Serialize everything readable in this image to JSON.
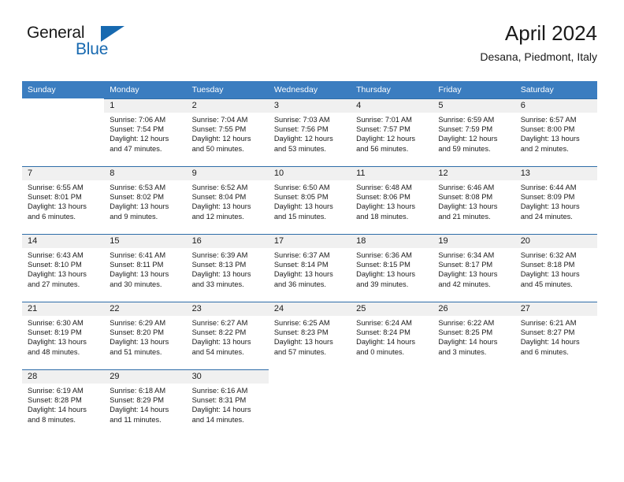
{
  "brand": {
    "name_part1": "General",
    "name_part2": "Blue",
    "logo_icon": "triangle-logo-icon"
  },
  "header": {
    "month_title": "April 2024",
    "location": "Desana, Piedmont, Italy"
  },
  "colors": {
    "header_blue": "#3b7dc0",
    "row_divider_blue": "#2e6da8",
    "daynum_background": "#f0f0f0",
    "brand_blue": "#1769b0",
    "text": "#1a1a1a"
  },
  "calendar": {
    "weekday_headers": [
      "Sunday",
      "Monday",
      "Tuesday",
      "Wednesday",
      "Thursday",
      "Friday",
      "Saturday"
    ],
    "weeks": [
      {
        "days": [
          {
            "day": "",
            "sunrise": "",
            "sunset": "",
            "daylight_line1": "",
            "daylight_line2": ""
          },
          {
            "day": "1",
            "sunrise": "Sunrise: 7:06 AM",
            "sunset": "Sunset: 7:54 PM",
            "daylight_line1": "Daylight: 12 hours",
            "daylight_line2": "and 47 minutes."
          },
          {
            "day": "2",
            "sunrise": "Sunrise: 7:04 AM",
            "sunset": "Sunset: 7:55 PM",
            "daylight_line1": "Daylight: 12 hours",
            "daylight_line2": "and 50 minutes."
          },
          {
            "day": "3",
            "sunrise": "Sunrise: 7:03 AM",
            "sunset": "Sunset: 7:56 PM",
            "daylight_line1": "Daylight: 12 hours",
            "daylight_line2": "and 53 minutes."
          },
          {
            "day": "4",
            "sunrise": "Sunrise: 7:01 AM",
            "sunset": "Sunset: 7:57 PM",
            "daylight_line1": "Daylight: 12 hours",
            "daylight_line2": "and 56 minutes."
          },
          {
            "day": "5",
            "sunrise": "Sunrise: 6:59 AM",
            "sunset": "Sunset: 7:59 PM",
            "daylight_line1": "Daylight: 12 hours",
            "daylight_line2": "and 59 minutes."
          },
          {
            "day": "6",
            "sunrise": "Sunrise: 6:57 AM",
            "sunset": "Sunset: 8:00 PM",
            "daylight_line1": "Daylight: 13 hours",
            "daylight_line2": "and 2 minutes."
          }
        ]
      },
      {
        "days": [
          {
            "day": "7",
            "sunrise": "Sunrise: 6:55 AM",
            "sunset": "Sunset: 8:01 PM",
            "daylight_line1": "Daylight: 13 hours",
            "daylight_line2": "and 6 minutes."
          },
          {
            "day": "8",
            "sunrise": "Sunrise: 6:53 AM",
            "sunset": "Sunset: 8:02 PM",
            "daylight_line1": "Daylight: 13 hours",
            "daylight_line2": "and 9 minutes."
          },
          {
            "day": "9",
            "sunrise": "Sunrise: 6:52 AM",
            "sunset": "Sunset: 8:04 PM",
            "daylight_line1": "Daylight: 13 hours",
            "daylight_line2": "and 12 minutes."
          },
          {
            "day": "10",
            "sunrise": "Sunrise: 6:50 AM",
            "sunset": "Sunset: 8:05 PM",
            "daylight_line1": "Daylight: 13 hours",
            "daylight_line2": "and 15 minutes."
          },
          {
            "day": "11",
            "sunrise": "Sunrise: 6:48 AM",
            "sunset": "Sunset: 8:06 PM",
            "daylight_line1": "Daylight: 13 hours",
            "daylight_line2": "and 18 minutes."
          },
          {
            "day": "12",
            "sunrise": "Sunrise: 6:46 AM",
            "sunset": "Sunset: 8:08 PM",
            "daylight_line1": "Daylight: 13 hours",
            "daylight_line2": "and 21 minutes."
          },
          {
            "day": "13",
            "sunrise": "Sunrise: 6:44 AM",
            "sunset": "Sunset: 8:09 PM",
            "daylight_line1": "Daylight: 13 hours",
            "daylight_line2": "and 24 minutes."
          }
        ]
      },
      {
        "days": [
          {
            "day": "14",
            "sunrise": "Sunrise: 6:43 AM",
            "sunset": "Sunset: 8:10 PM",
            "daylight_line1": "Daylight: 13 hours",
            "daylight_line2": "and 27 minutes."
          },
          {
            "day": "15",
            "sunrise": "Sunrise: 6:41 AM",
            "sunset": "Sunset: 8:11 PM",
            "daylight_line1": "Daylight: 13 hours",
            "daylight_line2": "and 30 minutes."
          },
          {
            "day": "16",
            "sunrise": "Sunrise: 6:39 AM",
            "sunset": "Sunset: 8:13 PM",
            "daylight_line1": "Daylight: 13 hours",
            "daylight_line2": "and 33 minutes."
          },
          {
            "day": "17",
            "sunrise": "Sunrise: 6:37 AM",
            "sunset": "Sunset: 8:14 PM",
            "daylight_line1": "Daylight: 13 hours",
            "daylight_line2": "and 36 minutes."
          },
          {
            "day": "18",
            "sunrise": "Sunrise: 6:36 AM",
            "sunset": "Sunset: 8:15 PM",
            "daylight_line1": "Daylight: 13 hours",
            "daylight_line2": "and 39 minutes."
          },
          {
            "day": "19",
            "sunrise": "Sunrise: 6:34 AM",
            "sunset": "Sunset: 8:17 PM",
            "daylight_line1": "Daylight: 13 hours",
            "daylight_line2": "and 42 minutes."
          },
          {
            "day": "20",
            "sunrise": "Sunrise: 6:32 AM",
            "sunset": "Sunset: 8:18 PM",
            "daylight_line1": "Daylight: 13 hours",
            "daylight_line2": "and 45 minutes."
          }
        ]
      },
      {
        "days": [
          {
            "day": "21",
            "sunrise": "Sunrise: 6:30 AM",
            "sunset": "Sunset: 8:19 PM",
            "daylight_line1": "Daylight: 13 hours",
            "daylight_line2": "and 48 minutes."
          },
          {
            "day": "22",
            "sunrise": "Sunrise: 6:29 AM",
            "sunset": "Sunset: 8:20 PM",
            "daylight_line1": "Daylight: 13 hours",
            "daylight_line2": "and 51 minutes."
          },
          {
            "day": "23",
            "sunrise": "Sunrise: 6:27 AM",
            "sunset": "Sunset: 8:22 PM",
            "daylight_line1": "Daylight: 13 hours",
            "daylight_line2": "and 54 minutes."
          },
          {
            "day": "24",
            "sunrise": "Sunrise: 6:25 AM",
            "sunset": "Sunset: 8:23 PM",
            "daylight_line1": "Daylight: 13 hours",
            "daylight_line2": "and 57 minutes."
          },
          {
            "day": "25",
            "sunrise": "Sunrise: 6:24 AM",
            "sunset": "Sunset: 8:24 PM",
            "daylight_line1": "Daylight: 14 hours",
            "daylight_line2": "and 0 minutes."
          },
          {
            "day": "26",
            "sunrise": "Sunrise: 6:22 AM",
            "sunset": "Sunset: 8:25 PM",
            "daylight_line1": "Daylight: 14 hours",
            "daylight_line2": "and 3 minutes."
          },
          {
            "day": "27",
            "sunrise": "Sunrise: 6:21 AM",
            "sunset": "Sunset: 8:27 PM",
            "daylight_line1": "Daylight: 14 hours",
            "daylight_line2": "and 6 minutes."
          }
        ]
      },
      {
        "days": [
          {
            "day": "28",
            "sunrise": "Sunrise: 6:19 AM",
            "sunset": "Sunset: 8:28 PM",
            "daylight_line1": "Daylight: 14 hours",
            "daylight_line2": "and 8 minutes."
          },
          {
            "day": "29",
            "sunrise": "Sunrise: 6:18 AM",
            "sunset": "Sunset: 8:29 PM",
            "daylight_line1": "Daylight: 14 hours",
            "daylight_line2": "and 11 minutes."
          },
          {
            "day": "30",
            "sunrise": "Sunrise: 6:16 AM",
            "sunset": "Sunset: 8:31 PM",
            "daylight_line1": "Daylight: 14 hours",
            "daylight_line2": "and 14 minutes."
          },
          {
            "day": "",
            "sunrise": "",
            "sunset": "",
            "daylight_line1": "",
            "daylight_line2": ""
          },
          {
            "day": "",
            "sunrise": "",
            "sunset": "",
            "daylight_line1": "",
            "daylight_line2": ""
          },
          {
            "day": "",
            "sunrise": "",
            "sunset": "",
            "daylight_line1": "",
            "daylight_line2": ""
          },
          {
            "day": "",
            "sunrise": "",
            "sunset": "",
            "daylight_line1": "",
            "daylight_line2": ""
          }
        ]
      }
    ]
  }
}
